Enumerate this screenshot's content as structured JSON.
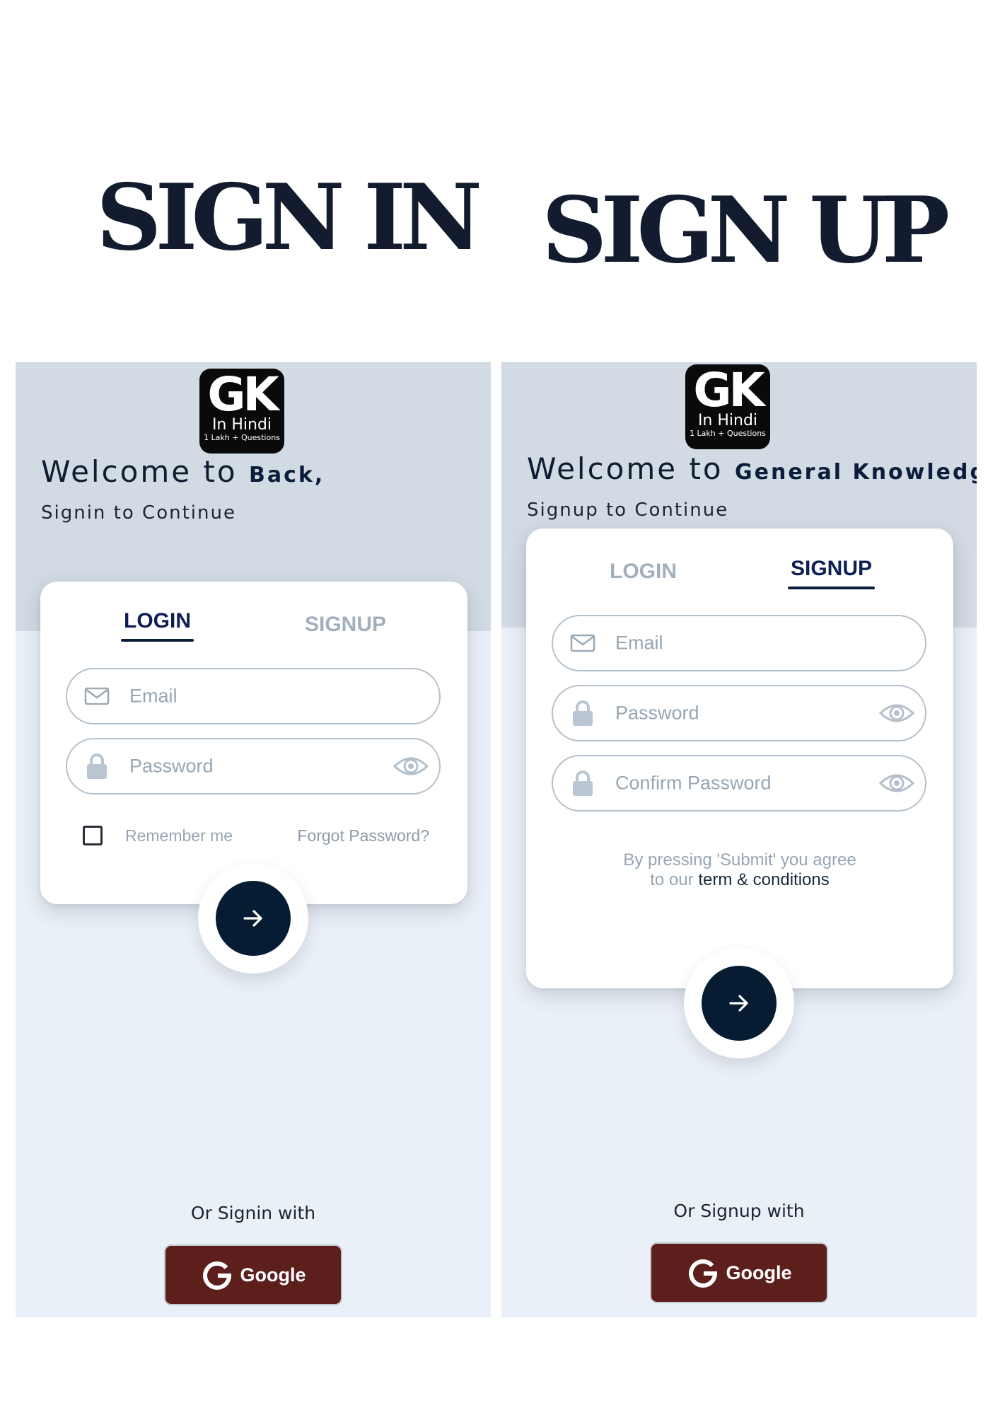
{
  "titles": {
    "signin": "SIGN IN",
    "signup": "SIGN UP"
  },
  "logo": {
    "main": "GK",
    "line2": "In Hindi",
    "line3": "1 Lakh + Questions"
  },
  "signin": {
    "welcome_prefix": "Welcome to",
    "welcome_bold": "Back,",
    "subtitle": "Signin to Continue",
    "tabs": {
      "login": "LOGIN",
      "signup": "SIGNUP",
      "active": "login"
    },
    "fields": {
      "email_placeholder": "Email",
      "password_placeholder": "Password"
    },
    "remember_label": "Remember me",
    "forgot_label": "Forgot Password?",
    "or_text": "Or Signin with",
    "google_label": "Google"
  },
  "signup": {
    "welcome_prefix": "Welcome to",
    "welcome_bold": "General Knowledge",
    "subtitle": "Signup to Continue",
    "tabs": {
      "login": "LOGIN",
      "signup": "SIGNUP",
      "active": "signup"
    },
    "fields": {
      "email_placeholder": "Email",
      "password_placeholder": "Password",
      "confirm_placeholder": "Confirm Password"
    },
    "terms_line1": "By pressing 'Submit' you agree",
    "terms_line2_prefix": "to our",
    "terms_link": "term & conditions",
    "or_text": "Or Signup with",
    "google_label": "Google"
  },
  "colors": {
    "header_band": "#d2dae4",
    "screen_bg": "#eaf0f7",
    "accent_navy": "#051c33",
    "google_button": "#5c1f1c",
    "muted_text": "#97a6b3"
  },
  "icons": [
    "mail-icon",
    "lock-icon",
    "eye-icon",
    "arrow-right-icon",
    "google-g-icon",
    "checkbox"
  ]
}
